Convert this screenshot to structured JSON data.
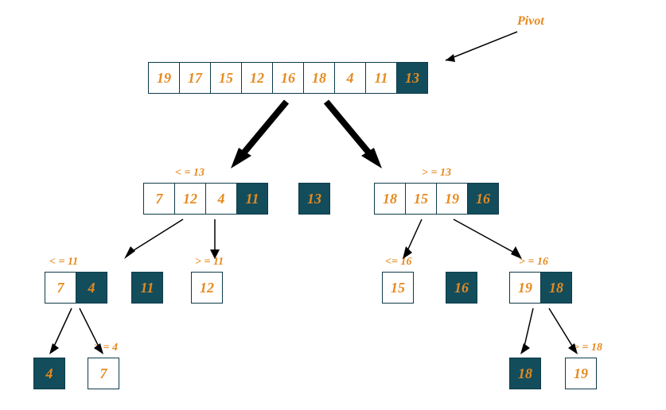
{
  "algorithm": "quicksort",
  "pivot_label": "Pivot",
  "top": {
    "cells": [
      "19",
      "17",
      "15",
      "12",
      "16",
      "18",
      "4",
      "11",
      "13"
    ],
    "pivot_index": 8
  },
  "level1": {
    "left": {
      "label": "< = 13",
      "cells": [
        "7",
        "12",
        "4",
        "11"
      ],
      "pivot_index": 3
    },
    "mid": {
      "cells": [
        "13"
      ],
      "pivot_index": 0
    },
    "right": {
      "label": "> = 13",
      "cells": [
        "18",
        "15",
        "19",
        "16"
      ],
      "pivot_index": 3
    }
  },
  "level2": {
    "l_left": {
      "label": "< = 11",
      "cells": [
        "7",
        "4"
      ],
      "pivot_index": 1
    },
    "l_mid": {
      "cells": [
        "11"
      ],
      "pivot_index": 0
    },
    "l_right": {
      "label": "> = 11",
      "cells": [
        "12"
      ],
      "pivot_index": null
    },
    "r_left": {
      "label": "<= 16",
      "cells": [
        "15"
      ],
      "pivot_index": null
    },
    "r_mid": {
      "cells": [
        "16"
      ],
      "pivot_index": 0
    },
    "r_right": {
      "label": "> = 16",
      "cells": [
        "19",
        "18"
      ],
      "pivot_index": 1
    }
  },
  "level3": {
    "ll_left": {
      "cells": [
        "4"
      ],
      "pivot_index": 0
    },
    "ll_right": {
      "label": "> = 4",
      "cells": [
        "7"
      ],
      "pivot_index": null
    },
    "rr_left": {
      "cells": [
        "18"
      ],
      "pivot_index": 0
    },
    "rr_right": {
      "label": "> = 18",
      "cells": [
        "19"
      ],
      "pivot_index": null
    }
  },
  "colors": {
    "pivot_bg": "#134d5c",
    "accent": "#e68a1f",
    "border": "#0d3b4a"
  }
}
